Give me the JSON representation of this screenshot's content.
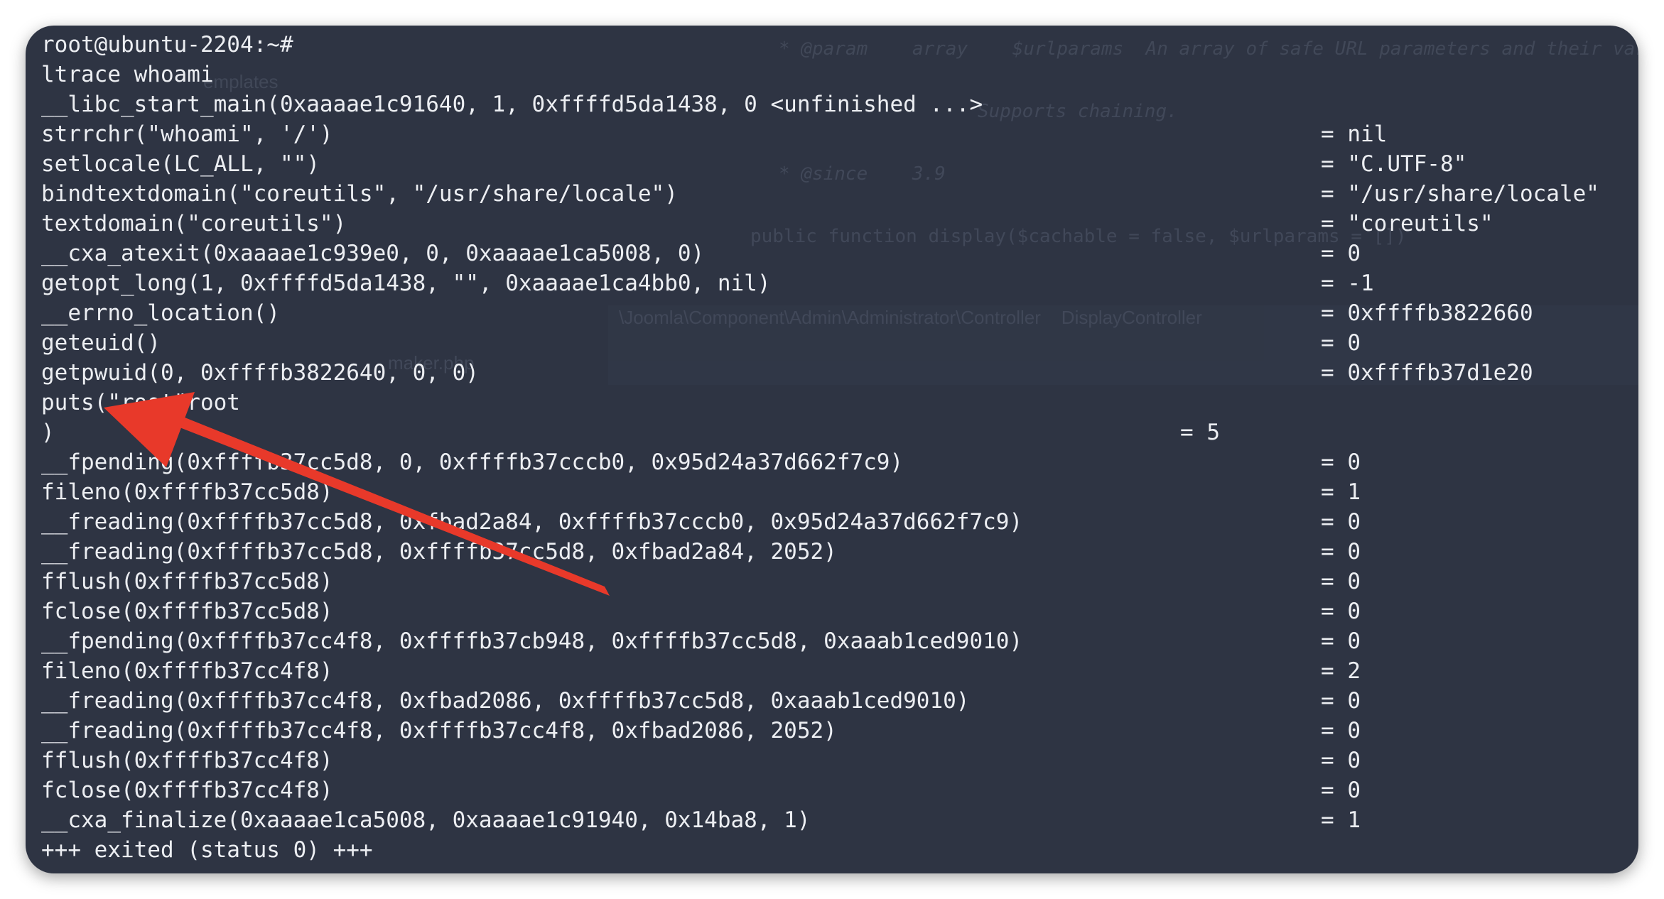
{
  "terminal": {
    "lines": [
      {
        "call": "root@ubuntu-2204:~#",
        "ret": ""
      },
      {
        "call": "ltrace whoami",
        "ret": ""
      },
      {
        "call": "__libc_start_main(0xaaaae1c91640, 1, 0xffffd5da1438, 0 <unfinished ...>",
        "ret": ""
      },
      {
        "call": "strrchr(\"whoami\", '/')",
        "ret": "= nil"
      },
      {
        "call": "setlocale(LC_ALL, \"\")",
        "ret": "= \"C.UTF-8\""
      },
      {
        "call": "bindtextdomain(\"coreutils\", \"/usr/share/locale\")",
        "ret": "= \"/usr/share/locale\""
      },
      {
        "call": "textdomain(\"coreutils\")",
        "ret": "= \"coreutils\""
      },
      {
        "call": "__cxa_atexit(0xaaaae1c939e0, 0, 0xaaaae1ca5008, 0)",
        "ret": "= 0"
      },
      {
        "call": "getopt_long(1, 0xffffd5da1438, \"\", 0xaaaae1ca4bb0, nil)",
        "ret": "= -1"
      },
      {
        "call": "__errno_location()",
        "ret": "= 0xffffb3822660"
      },
      {
        "call": "geteuid()",
        "ret": "= 0"
      },
      {
        "call": "getpwuid(0, 0xffffb3822640, 0, 0)",
        "ret": "= 0xffffb37d1e20"
      },
      {
        "call": "puts(\"root\"root",
        "ret": ""
      },
      {
        "call": ")",
        "ret_mid": "= 5"
      },
      {
        "call": "__fpending(0xffffb37cc5d8, 0, 0xffffb37cccb0, 0x95d24a37d662f7c9)",
        "ret": "= 0"
      },
      {
        "call": "fileno(0xffffb37cc5d8)",
        "ret": "= 1"
      },
      {
        "call": "__freading(0xffffb37cc5d8, 0xfbad2a84, 0xffffb37cccb0, 0x95d24a37d662f7c9)",
        "ret": "= 0"
      },
      {
        "call": "__freading(0xffffb37cc5d8, 0xffffb37cc5d8, 0xfbad2a84, 2052)",
        "ret": "= 0"
      },
      {
        "call": "fflush(0xffffb37cc5d8)",
        "ret": "= 0"
      },
      {
        "call": "fclose(0xffffb37cc5d8)",
        "ret": "= 0"
      },
      {
        "call": "__fpending(0xffffb37cc4f8, 0xffffb37cb948, 0xffffb37cc5d8, 0xaaab1ced9010)",
        "ret": "= 0"
      },
      {
        "call": "fileno(0xffffb37cc4f8)",
        "ret": "= 2"
      },
      {
        "call": "__freading(0xffffb37cc4f8, 0xfbad2086, 0xffffb37cc5d8, 0xaaab1ced9010)",
        "ret": "= 0"
      },
      {
        "call": "__freading(0xffffb37cc4f8, 0xffffb37cc4f8, 0xfbad2086, 2052)",
        "ret": "= 0"
      },
      {
        "call": "fflush(0xffffb37cc4f8)",
        "ret": "= 0"
      },
      {
        "call": "fclose(0xffffb37cc4f8)",
        "ret": "= 0"
      },
      {
        "call": "__cxa_finalize(0xaaaae1ca5008, 0xaaaae1c91940, 0x14ba8, 1)",
        "ret": "= 1"
      },
      {
        "call": "+++ exited (status 0) +++",
        "ret": ""
      }
    ]
  },
  "background_ghost": {
    "lines": [
      "* @param    array    $urlparams  An array of safe URL parameters and their var",
      "Supports chaining.",
      "* @since    3.9",
      "public function display($cachable = false, $urlparams = [])",
      "\\Joomla\\Component\\Admin\\Administrator\\Controller    DisplayController",
      "emplates",
      "maker.php"
    ]
  },
  "colors": {
    "terminal_bg": "#2e3443",
    "text": "#eceef2",
    "arrow": "#e8392a"
  }
}
